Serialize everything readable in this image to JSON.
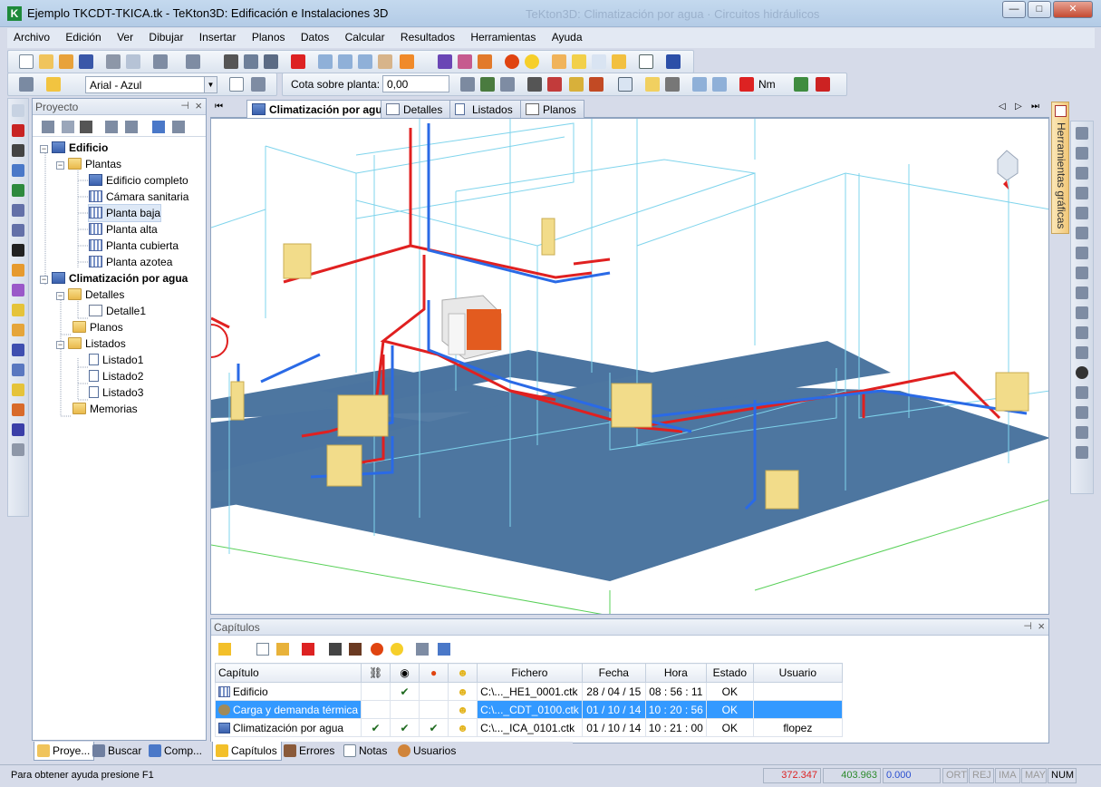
{
  "window": {
    "title": "Ejemplo TKCDT-TKICA.tk - TeKton3D: Edificación e Instalaciones 3D",
    "ghost_title": "TeKton3D: Climatización por agua · Circuitos hidráulicos",
    "minimize": "—",
    "maximize": "□",
    "close": "✕"
  },
  "menu": [
    "Archivo",
    "Edición",
    "Ver",
    "Dibujar",
    "Insertar",
    "Planos",
    "Datos",
    "Calcular",
    "Resultados",
    "Herramientas",
    "Ayuda"
  ],
  "toolbar2": {
    "font_value": "Arial - Azul",
    "cota_label": "Cota sobre planta:",
    "cota_value": "0,00",
    "nm_label": "Nm"
  },
  "project_panel": {
    "title": "Proyecto",
    "tree": [
      {
        "label": "Edificio",
        "bold": true
      },
      {
        "label": "Plantas"
      },
      {
        "label": "Edificio completo"
      },
      {
        "label": "Cámara sanitaria"
      },
      {
        "label": "Planta baja"
      },
      {
        "label": "Planta alta"
      },
      {
        "label": "Planta cubierta"
      },
      {
        "label": "Planta azotea"
      },
      {
        "label": "Climatización por agua",
        "bold": true
      },
      {
        "label": "Detalles"
      },
      {
        "label": "Detalle1"
      },
      {
        "label": "Planos"
      },
      {
        "label": "Listados"
      },
      {
        "label": "Listado1"
      },
      {
        "label": "Listado2"
      },
      {
        "label": "Listado3"
      },
      {
        "label": "Memorias"
      }
    ],
    "tabs": [
      "Proye...",
      "Buscar",
      "Comp..."
    ]
  },
  "view_tabs": [
    "Climatización por agua",
    "Detalles",
    "Listados",
    "Planos"
  ],
  "side_label": "Herramientas gráficas",
  "chapters": {
    "title": "Capítulos",
    "columns": [
      "Capítulo",
      "Fichero",
      "Fecha",
      "Hora",
      "Estado",
      "Usuario"
    ],
    "rows": [
      {
        "capitulo": "Edificio",
        "fichero": "C:\\..._HE1_0001.ctk",
        "fecha": "28 / 04 / 15",
        "hora": "08 : 56 : 11",
        "estado": "OK",
        "usuario": "",
        "c1": "",
        "c2": "✔",
        "c3": ""
      },
      {
        "capitulo": "Carga y demanda térmica",
        "fichero": "C:\\..._CDT_0100.ctk",
        "fecha": "01 / 10 / 14",
        "hora": "10 : 20 : 56",
        "estado": "OK",
        "usuario": "",
        "c1": "",
        "c2": "",
        "c3": ""
      },
      {
        "capitulo": "Climatización por agua",
        "fichero": "C:\\..._ICA_0101.ctk",
        "fecha": "01 / 10 / 14",
        "hora": "10 : 21 : 00",
        "estado": "OK",
        "usuario": "flopez",
        "c1": "✔",
        "c2": "✔",
        "c3": "✔"
      }
    ],
    "tabs": [
      "Capítulos",
      "Errores",
      "Notas",
      "Usuarios"
    ]
  },
  "status": {
    "help": "Para obtener ayuda presione F1",
    "x": "372.347",
    "y": "403.963",
    "z": "0.000",
    "indicators": [
      "ORT",
      "REJ",
      "IMA",
      "MAY",
      "NUM"
    ]
  }
}
